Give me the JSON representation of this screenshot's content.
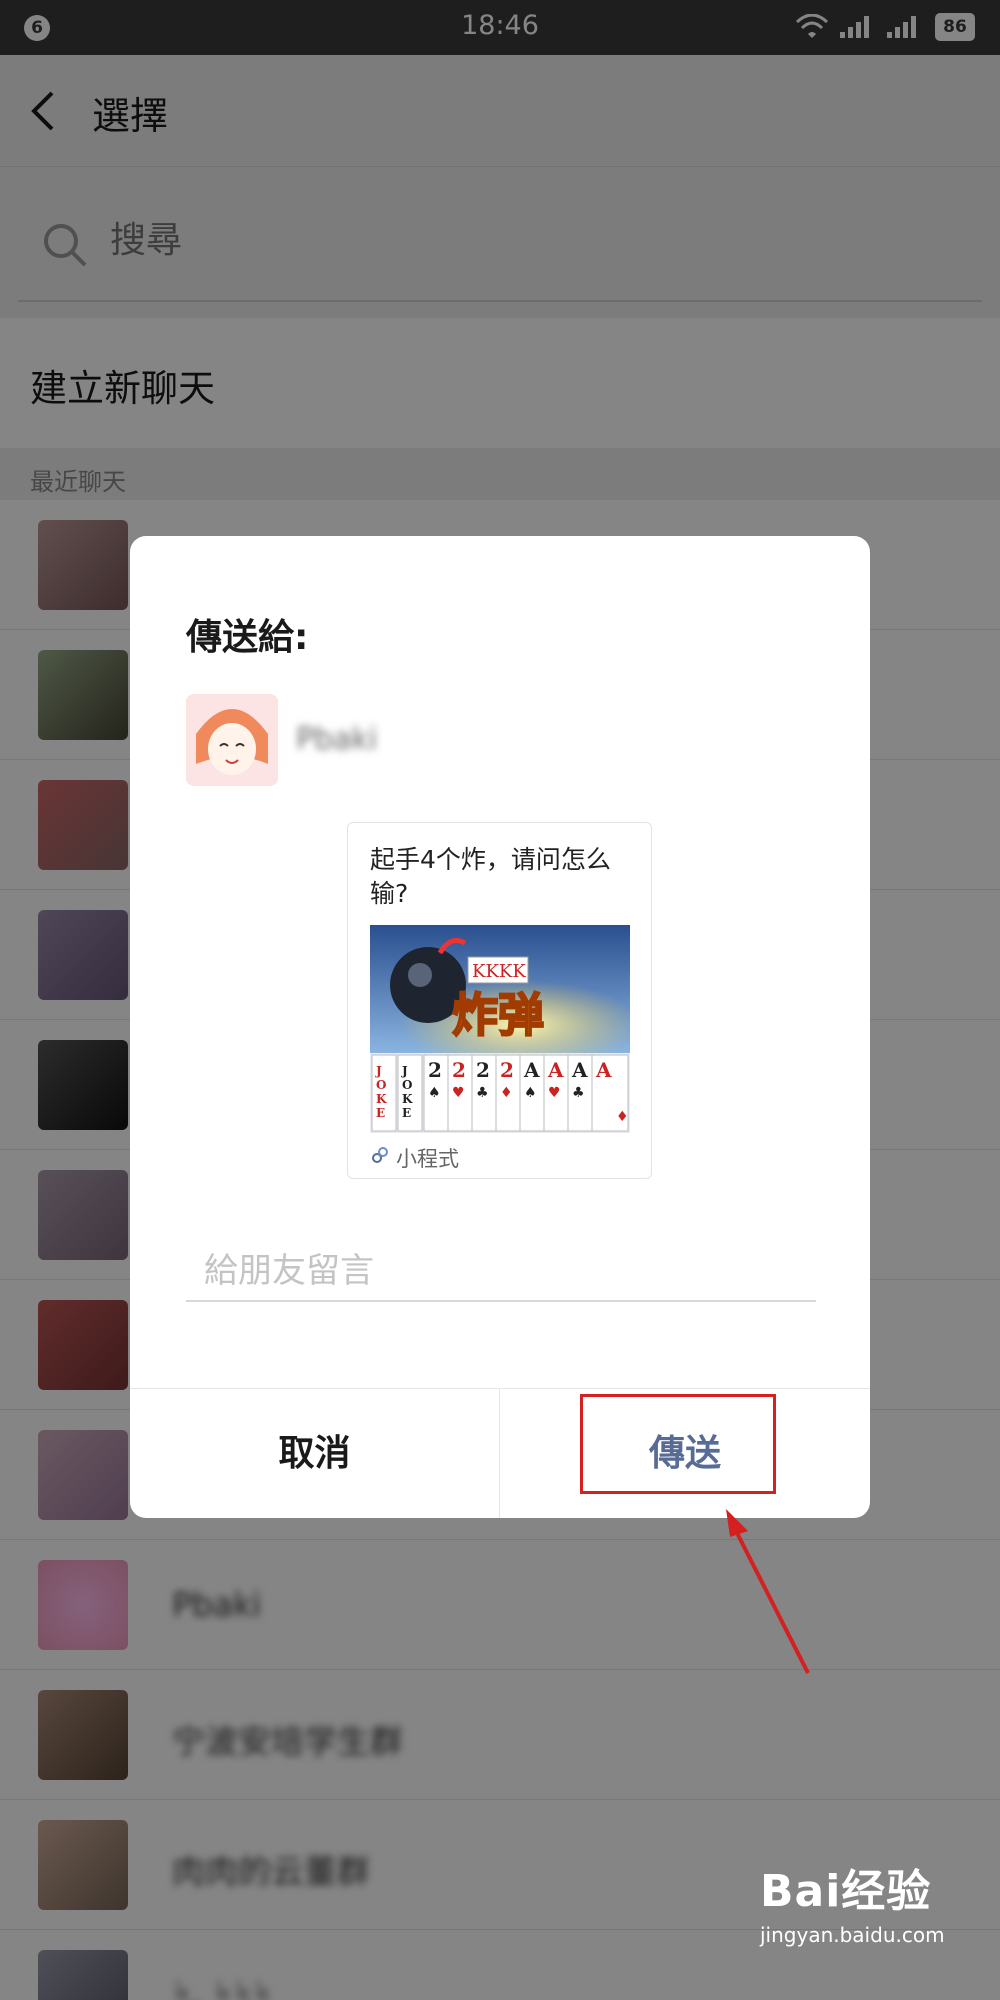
{
  "status_bar": {
    "notification_count": "6",
    "time": "18:46",
    "battery": "86",
    "icons": [
      "wifi-icon",
      "signal-icon",
      "signal-icon",
      "battery-icon"
    ]
  },
  "header": {
    "title": "選擇",
    "back_icon": "back-arrow-icon"
  },
  "search": {
    "placeholder": "搜尋",
    "icon": "search-icon"
  },
  "new_chat_label": "建立新聊天",
  "recent_label": "最近聊天",
  "chat_list": {
    "names": [
      "Pbaki",
      "宁波安培学生群",
      "肉肉的云董群",
      "ᛋ, ᛋᛋᛋ"
    ],
    "avatar_colors": [
      "#b99",
      "#9a8",
      "#c66",
      "#98a",
      "#333",
      "#a9a",
      "#b55",
      "#cab",
      "#e9b",
      "#a87",
      "#ca9",
      "#99a"
    ]
  },
  "dialog": {
    "heading": "傳送給:",
    "recipient_name": "Pbaki",
    "card": {
      "title": "起手4个炸，请问怎么输?",
      "image_text": "炸弹",
      "mini_program_label": "小程式",
      "cards": [
        "JOKER",
        "JOKER",
        "2",
        "2",
        "2",
        "2",
        "A",
        "A",
        "A",
        "A"
      ]
    },
    "message_placeholder": "給朋友留言",
    "cancel_label": "取消",
    "send_label": "傳送"
  },
  "watermark": {
    "brand": "Bai经验",
    "url": "jingyan.baidu.com"
  },
  "colors": {
    "send_button": "#576b95",
    "highlight": "#d42020",
    "status_bar": "#3a3a3a"
  }
}
